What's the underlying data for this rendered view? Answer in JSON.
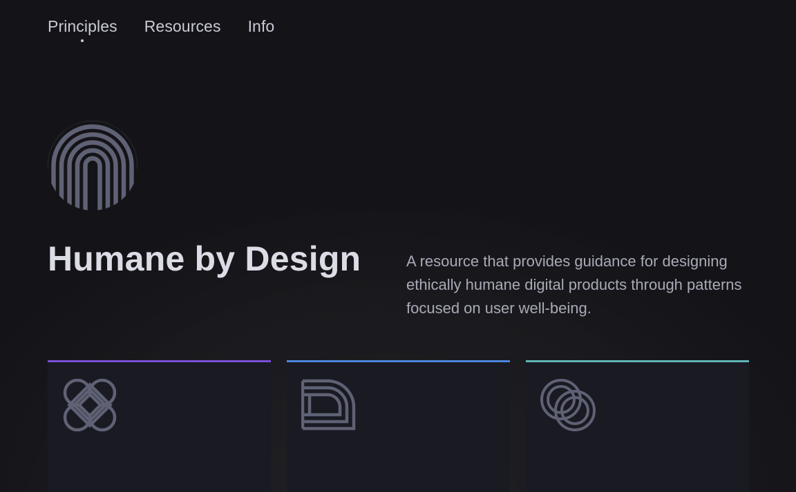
{
  "nav": {
    "items": [
      {
        "label": "Principles",
        "active": true
      },
      {
        "label": "Resources",
        "active": false
      },
      {
        "label": "Info",
        "active": false
      }
    ]
  },
  "hero": {
    "logo_icon": "fingerprint-arch-icon",
    "title": "Humane by Design",
    "tagline": "A resource that provides guidance for designing ethically humane digital products through patterns focused on user well-being."
  },
  "cards": [
    {
      "icon": "interlocked-diamond-icon",
      "accent": "#7b4fd8"
    },
    {
      "icon": "nested-curve-icon",
      "accent": "#4a86dd"
    },
    {
      "icon": "linked-rings-icon",
      "accent": "#5fb6b6"
    }
  ],
  "colors": {
    "background": "#141418",
    "card_background": "#191a22",
    "icon": "#5f6174",
    "nav_text": "#c9cad6",
    "title_text": "#dcdce6",
    "body_text": "#a9aab8"
  }
}
